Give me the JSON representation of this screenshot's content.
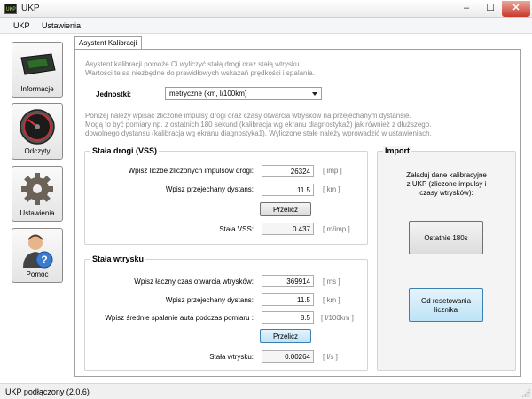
{
  "window": {
    "app_icon_text": "UKP",
    "title": "UKP",
    "minimize_glyph": "–",
    "maximize_glyph": "☐",
    "close_glyph": "✕"
  },
  "menu": {
    "items": [
      "UKP",
      "Ustawienia"
    ]
  },
  "nav": [
    {
      "label": "Informacje",
      "icon": "device-icon"
    },
    {
      "label": "Odczyty",
      "icon": "gauge-icon"
    },
    {
      "label": "Ustawienia",
      "icon": "gear-icon"
    },
    {
      "label": "Pomoc",
      "icon": "help-person-icon"
    }
  ],
  "tab": {
    "label": "Asystent Kalibracji"
  },
  "intro": {
    "line1": "Asystent kalibracji pomoże Ci wyliczyć stałą drogi oraz stałą wtrysku.",
    "line2": "Wartości te są niezbędne do prawidłowych wskazań prędkości i spalania."
  },
  "units": {
    "label": "Jednostki:",
    "selected": "metryczne (km, l/100km)"
  },
  "instructions": {
    "line1": "Poniżej należy wpisać zliczone impulsy drogi oraz czasy otwarcia wtrysków na przejechanym dystansie.",
    "line2": "Mogą to być pomiary np. z ostatnich 180 sekund (kalibracja wg ekranu diagnostyka2) jak również z dłuższego.",
    "line3": "dowolnego dystansu (kalibracja wg ekranu diagnostyka1). Wyliczone stałe należy wprowadzić w ustawieniach."
  },
  "vss": {
    "title": "Stała drogi (VSS)",
    "impulses_label": "Wpisz liczbe zliczonych impulsów drogi:",
    "impulses_value": "26324",
    "impulses_unit": "[ imp ]",
    "distance_label": "Wpisz przejechany dystans:",
    "distance_value": "11.5",
    "distance_unit": "[ km ]",
    "calc_button": "Przelicz",
    "result_label": "Stała VSS:",
    "result_value": "0.437",
    "result_unit": "[ m/imp ]"
  },
  "injection": {
    "title": "Stała wtrysku",
    "time_label": "Wpisz łaczny czas otwarcia wtrysków:",
    "time_value": "369914",
    "time_unit": "[ ms ]",
    "distance_label": "Wpisz przejechany dystans:",
    "distance_value": "11.5",
    "distance_unit": "[ km ]",
    "consumption_label": "Wpisz średnie spalanie auta podczas pomiaru :",
    "consumption_value": "8.5",
    "consumption_unit": "[ l/100km ]",
    "calc_button": "Przelicz",
    "result_label": "Stała wtrysku:",
    "result_value": "0.00264",
    "result_unit": "[ l/s ]"
  },
  "import": {
    "title": "Import",
    "desc1": "Załaduj dane kalibracyjne",
    "desc2": "z UKP (zliczone impulsy i",
    "desc3": "czasy wtrysków):",
    "last180_button": "Ostatnie 180s",
    "since_reset_line1": "Od resetowania",
    "since_reset_line2": "licznika"
  },
  "status": {
    "text": "UKP podłączony (2.0.6)"
  }
}
